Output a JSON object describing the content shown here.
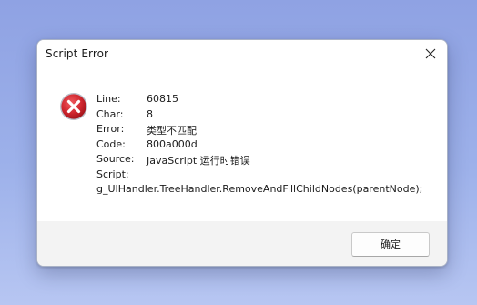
{
  "dialog": {
    "title": "Script Error",
    "close_icon": "close-icon",
    "error_icon": "error-icon",
    "fields": [
      {
        "label": "Line:",
        "value": "60815"
      },
      {
        "label": "Char:",
        "value": "8"
      },
      {
        "label": "Error:",
        "value": "类型不匹配"
      },
      {
        "label": "Code:",
        "value": "800a000d"
      },
      {
        "label": "Source:",
        "value": "JavaScript 运行时错误"
      }
    ],
    "script_label": "Script:",
    "script_value": "g_UIHandler.TreeHandler.RemoveAndFillChildNodes(parentNode);",
    "ok_label": "确定"
  },
  "colors": {
    "desktop": "#8fa2e3",
    "error_red": "#c9232c",
    "dialog_bg": "#ffffff",
    "footer_bg": "#f3f3f3"
  }
}
